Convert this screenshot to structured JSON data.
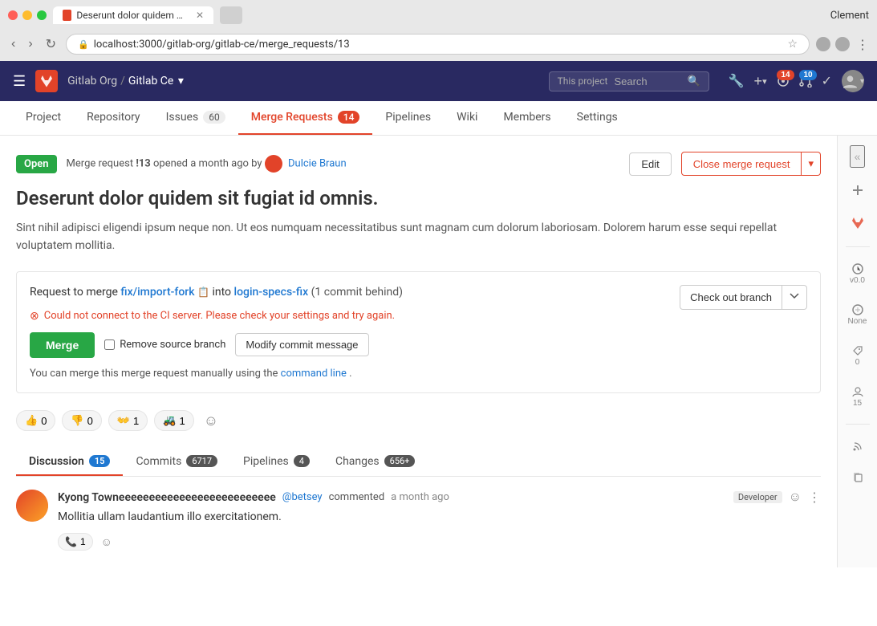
{
  "browser": {
    "tab_title": "Deserunt dolor quidem sit fug...",
    "url": "localhost:3000/gitlab-org/gitlab-ce/merge_requests/13",
    "user_name": "Clement"
  },
  "header": {
    "org": "Gitlab Org",
    "separator": "/",
    "project": "Gitlab Ce",
    "search_placeholder": "This project",
    "search_label": "Search",
    "wrench_icon": "🔧",
    "plus_icon": "+",
    "badge_14": "14",
    "badge_10": "10",
    "checkmark_icon": "✓"
  },
  "nav_tabs": [
    {
      "label": "Project",
      "count": null,
      "active": false
    },
    {
      "label": "Repository",
      "count": null,
      "active": false
    },
    {
      "label": "Issues",
      "count": "60",
      "active": false
    },
    {
      "label": "Merge Requests",
      "count": "14",
      "active": true
    },
    {
      "label": "Pipelines",
      "count": null,
      "active": false
    },
    {
      "label": "Wiki",
      "count": null,
      "active": false
    },
    {
      "label": "Members",
      "count": null,
      "active": false
    },
    {
      "label": "Settings",
      "count": null,
      "active": false
    }
  ],
  "mr": {
    "status": "Open",
    "number": "!13",
    "opened_text": "opened a month ago by",
    "author": "Dulcie Braun",
    "edit_label": "Edit",
    "close_label": "Close merge request",
    "title": "Deserunt dolor quidem sit fugiat id omnis.",
    "description": "Sint nihil adipisci eligendi ipsum neque non. Ut eos numquam necessitatibus sunt magnam cum dolorum laboriosam. Dolorem harum esse sequi repellat voluptatem mollitia.",
    "merge_label": "Request to merge",
    "source_branch": "fix/import-fork",
    "into_label": "into",
    "target_branch": "login-specs-fix",
    "behind_text": "(1 commit behind)",
    "checkout_label": "Check out branch",
    "ci_error": "Could not connect to the CI server. Please check your settings and try again.",
    "merge_btn": "Merge",
    "remove_source_label": "Remove source branch",
    "modify_commit_label": "Modify commit message",
    "manual_merge_text": "You can merge this merge request manually using the",
    "command_line_link": "command line",
    "manual_merge_end": "."
  },
  "emoji_reactions": [
    {
      "emoji": "👍",
      "count": "0"
    },
    {
      "emoji": "👎",
      "count": "0"
    },
    {
      "emoji": "👐",
      "count": "1"
    },
    {
      "emoji": "🚜",
      "count": "1"
    }
  ],
  "discussion_tabs": [
    {
      "label": "Discussion",
      "count": "15",
      "active": true
    },
    {
      "label": "Commits",
      "count": "6717",
      "active": false
    },
    {
      "label": "Pipelines",
      "count": "4",
      "active": false
    },
    {
      "label": "Changes",
      "count": "656+",
      "active": false
    }
  ],
  "comment": {
    "author": "Kyong Towneeeeeeeeeeeeeeeeeeeeeeeeee",
    "handle": "@betsey",
    "verb": "commented",
    "time": "a month ago",
    "role": "Developer",
    "text": "Mollitia ullam laudantium illo exercitationem.",
    "reaction_emoji": "📞",
    "reaction_count": "1"
  },
  "right_sidebar": {
    "expand_label": "«",
    "plus_icon": "+",
    "time_label": "v0.0",
    "none_label": "None",
    "tag_count": "0",
    "people_count": "15",
    "rss_icon": "rss",
    "copy_icon": "copy"
  }
}
